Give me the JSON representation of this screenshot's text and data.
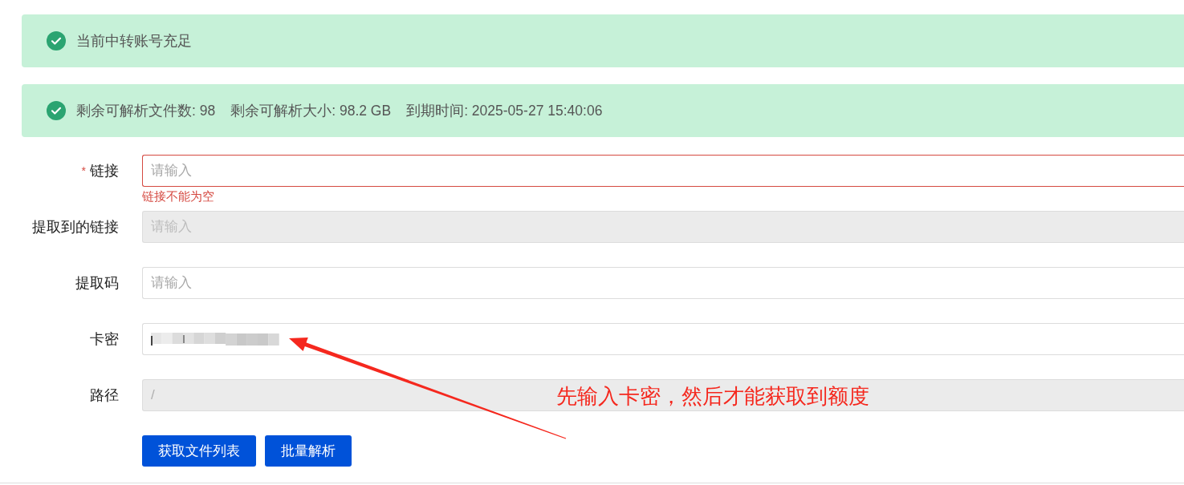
{
  "alerts": [
    {
      "kind": "success",
      "texts": [
        "当前中转账号充足"
      ]
    },
    {
      "kind": "success",
      "texts": [
        "剩余可解析文件数: 98",
        "剩余可解析大小: 98.2 GB",
        "到期时间: 2025-05-27 15:40:06"
      ]
    }
  ],
  "form": {
    "fields": [
      {
        "label": "链接",
        "required_mark": "*",
        "placeholder": "请输入",
        "disabled": false,
        "error": "链接不能为空"
      },
      {
        "label": "提取到的链接",
        "placeholder": "请输入",
        "disabled": true
      },
      {
        "label": "提取码",
        "placeholder": "请输入",
        "disabled": false
      },
      {
        "label": "卡密",
        "disabled": false,
        "redacted": true
      },
      {
        "label": "路径",
        "value": "/",
        "disabled": true
      }
    ],
    "buttons": [
      "获取文件列表",
      "批量解析"
    ]
  },
  "annotation": {
    "text": "先输入卡密，然后才能获取到额度"
  }
}
